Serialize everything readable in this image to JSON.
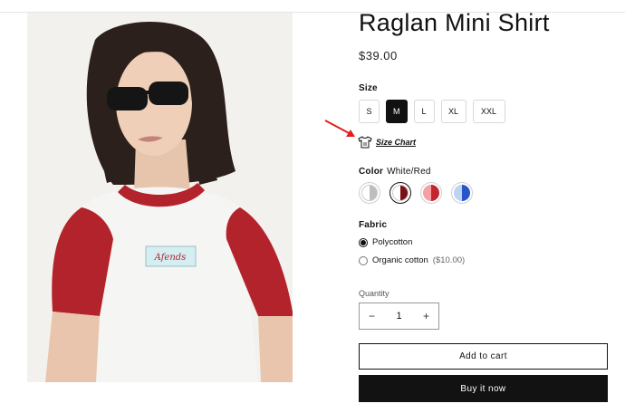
{
  "product": {
    "title": "Raglan Mini Shirt",
    "price": "$39.00",
    "image_alt": "Model wearing a white and red raglan mini shirt",
    "shirt_patch_text": "Afends"
  },
  "size": {
    "label": "Size",
    "options": [
      "S",
      "M",
      "L",
      "XL",
      "XXL"
    ],
    "selected": "M"
  },
  "size_chart": {
    "label": "Size Chart",
    "icon": "shirt-icon"
  },
  "color": {
    "label": "Color",
    "selected_name": "White/Red",
    "swatches": [
      {
        "left": "#ffffff",
        "right": "#bdbdbd"
      },
      {
        "left": "#ffffff",
        "right": "#7a1115"
      },
      {
        "left": "#f4a0a4",
        "right": "#c2262e"
      },
      {
        "left": "#bcd3f2",
        "right": "#2a55c9"
      }
    ]
  },
  "fabric": {
    "label": "Fabric",
    "options": [
      {
        "name": "Polycotton",
        "extra": "",
        "checked": true
      },
      {
        "name": "Organic cotton",
        "extra": "($10.00)",
        "checked": false
      }
    ]
  },
  "quantity": {
    "label": "Quantity",
    "value": "1",
    "decrement": "−",
    "increment": "+"
  },
  "actions": {
    "add_to_cart": "Add to cart",
    "buy_now": "Buy it now"
  },
  "colors": {
    "annotation_arrow": "#e0201b",
    "primary": "#121212",
    "shirt_red": "#b3232b"
  }
}
